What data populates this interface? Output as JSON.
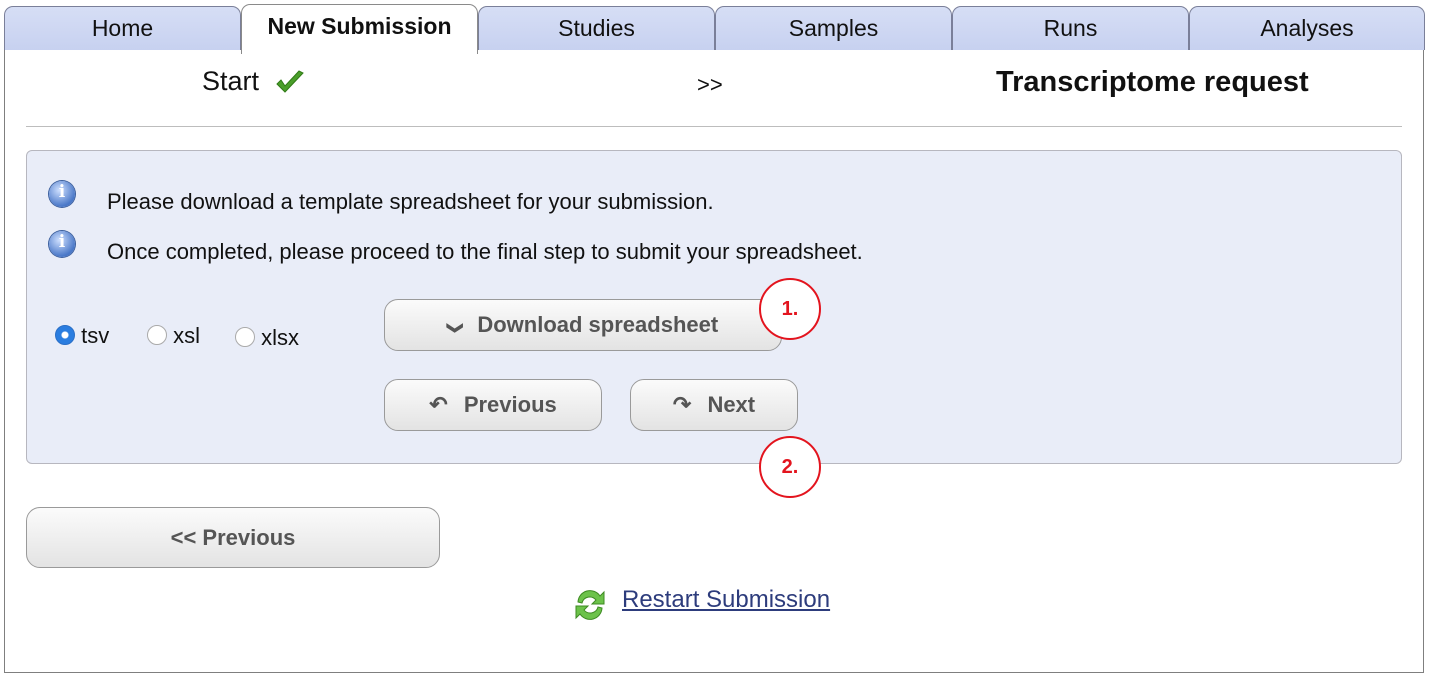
{
  "tabs": [
    {
      "label": "Home",
      "active": false
    },
    {
      "label": "New Submission",
      "active": true
    },
    {
      "label": "Studies",
      "active": false
    },
    {
      "label": "Samples",
      "active": false
    },
    {
      "label": "Runs",
      "active": false
    },
    {
      "label": "Analyses",
      "active": false
    }
  ],
  "steps": {
    "start_label": "Start",
    "separator": ">>",
    "current_label": "Transcriptome request"
  },
  "panel": {
    "info_1": "Please download a template spreadsheet for your submission.",
    "info_2": "Once completed, please proceed to the final step to submit your spreadsheet.",
    "formats": [
      {
        "label": "tsv",
        "selected": true
      },
      {
        "label": "xsl",
        "selected": false
      },
      {
        "label": "xlsx",
        "selected": false
      }
    ],
    "download_label": "Download spreadsheet",
    "previous_label": "Previous",
    "next_label": "Next"
  },
  "annotations": {
    "marker_1": "1.",
    "marker_2": "2."
  },
  "footer": {
    "previous_label": "<< Previous",
    "restart_label": "Restart Submission"
  },
  "icons": {
    "check": "check-icon",
    "info": "info-icon",
    "chevron": "chevron-down-icon",
    "undo": "undo-arrow-icon",
    "redo": "redo-arrow-icon",
    "refresh": "refresh-icon"
  },
  "colors": {
    "tab_bg": "#c7d1f0",
    "panel_bg": "#e9edf8",
    "check_green": "#4a9e2a",
    "marker_red": "#e3141e",
    "link": "#2d3c7c",
    "radio_selected": "#2a7de0"
  }
}
